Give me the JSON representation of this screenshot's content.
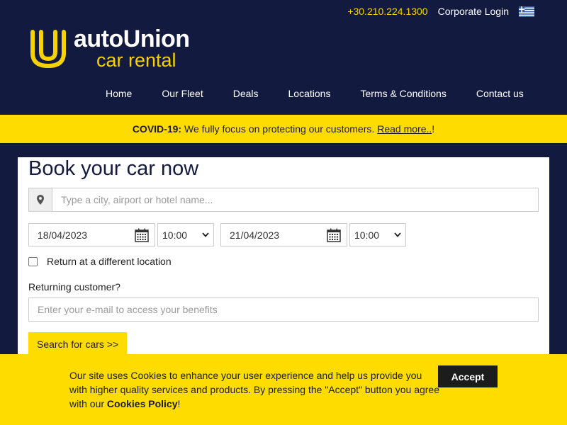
{
  "header": {
    "phone": "+30.210.224.1300",
    "corporate_login": "Corporate Login",
    "logo_brand": "autoUnion",
    "logo_sub": "car rental",
    "language_flag": "greek-flag-icon"
  },
  "nav": {
    "items": [
      "Home",
      "Our Fleet",
      "Deals",
      "Locations",
      "Terms & Conditions",
      "Contact us"
    ]
  },
  "banner": {
    "label": "COVID-19:",
    "text": "We fully focus on protecting our customers.",
    "link": "Read more..",
    "suffix": "!"
  },
  "booking": {
    "title": "Book your car now",
    "location_icon": "map-marker-icon",
    "location_placeholder": "Type a city, airport or hotel name...",
    "pickup_date": "18/04/2023",
    "pickup_time": "10:00",
    "return_date": "21/04/2023",
    "return_time": "10:00",
    "return_different_label": "Return at a different location",
    "returning_customer_label": "Returning customer?",
    "email_placeholder": "Enter your e-mail to access your benefits",
    "search_button": "Search for cars >>"
  },
  "cookie": {
    "text_before": "Our site uses Cookies to enhance your user experience and help us provide you with higher quality services and products. By pressing the \"Accept\" button you agree with our ",
    "policy_link": "Cookies Policy",
    "text_after": "!",
    "accept_button": "Accept"
  },
  "colors": {
    "navy": "#131a40",
    "yellow": "#fedc00",
    "accent_text": "#f5d200"
  }
}
